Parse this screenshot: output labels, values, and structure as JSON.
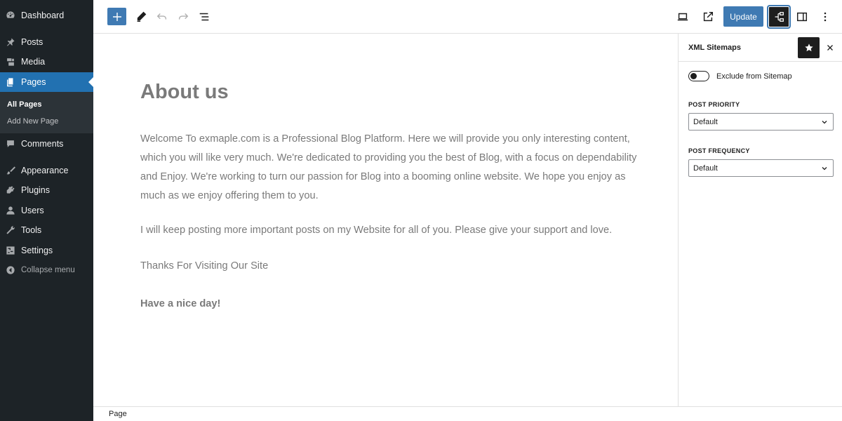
{
  "sidebar": {
    "items": [
      {
        "label": "Dashboard",
        "icon": "dashboard-icon"
      },
      {
        "label": "Posts",
        "icon": "pin-icon"
      },
      {
        "label": "Media",
        "icon": "media-icon"
      },
      {
        "label": "Pages",
        "icon": "pages-icon",
        "active": true
      },
      {
        "label": "Comments",
        "icon": "comment-icon"
      },
      {
        "label": "Appearance",
        "icon": "brush-icon"
      },
      {
        "label": "Plugins",
        "icon": "plugin-icon"
      },
      {
        "label": "Users",
        "icon": "user-icon"
      },
      {
        "label": "Tools",
        "icon": "wrench-icon"
      },
      {
        "label": "Settings",
        "icon": "settings-icon"
      },
      {
        "label": "Collapse menu",
        "icon": "collapse-icon"
      }
    ],
    "submenu": [
      {
        "label": "All Pages",
        "current": true
      },
      {
        "label": "Add New Page"
      }
    ]
  },
  "toolbar": {
    "update_label": "Update",
    "accent": "#3f7ab3"
  },
  "editor": {
    "title": "About us",
    "paragraphs": [
      "Welcome To exmaple.com is a Professional Blog Platform. Here we will provide you only interesting content, which you will like very much. We're dedicated to providing you the best of Blog, with a focus on dependability and Enjoy. We're working to turn our passion for Blog into a booming online website. We hope you enjoy as much as we enjoy offering them to you.",
      "I will keep posting more important posts on my Website for all of you. Please give your support and love.",
      "Thanks For Visiting Our Site",
      "Have a nice day!"
    ]
  },
  "panel": {
    "title": "XML Sitemaps",
    "toggle_label": "Exclude from Sitemap",
    "toggle_on": false,
    "priority_label": "POST PRIORITY",
    "priority_value": "Default",
    "frequency_label": "POST FREQUENCY",
    "frequency_value": "Default"
  },
  "footer": {
    "breadcrumb": "Page"
  }
}
